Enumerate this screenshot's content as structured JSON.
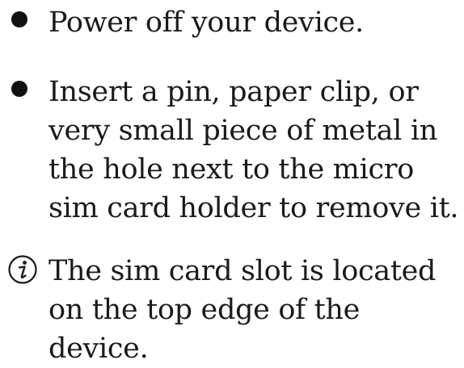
{
  "steps": [
    {
      "text": "Power off your device.",
      "icon": "bullet-icon"
    },
    {
      "text": "Insert a pin, paper clip, or very small piece of metal in the hole next to the micro sim card holder to remove it.",
      "icon": "bullet-icon"
    }
  ],
  "note": {
    "icon": "info-icon",
    "text": "The sim card slot is located on the top edge of the device."
  },
  "colors": {
    "text": "#1a1a1a",
    "bullet": "#111111",
    "background": "#ffffff"
  }
}
